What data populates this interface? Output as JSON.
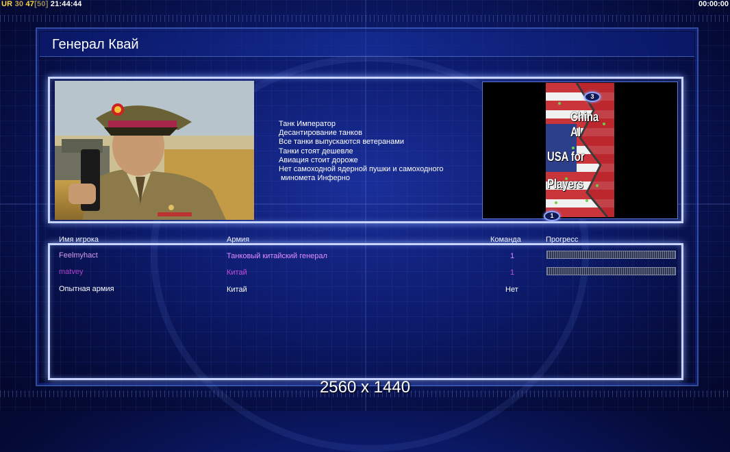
{
  "status": {
    "ur": "UR",
    "v1": "30",
    "v2": "47",
    "v3": "[50]",
    "clock": "21:44:44",
    "timer": "00:00:00"
  },
  "title": "Генерал Квай",
  "features": [
    "Танк Император",
    "Десантирование танков",
    "Все танки выпускаются ветеранами",
    "Танки стоят дешевле",
    "Авиация стоит дороже",
    "Нет самоходной ядерной пушки и самоходного",
    " минометa Инферно"
  ],
  "map": {
    "line1": "China AI",
    "line2": "USA for",
    "line3": "Players",
    "marker_top": "3",
    "marker_bottom": "1"
  },
  "table": {
    "headers": {
      "player": "Имя игрока",
      "army": "Армия",
      "team": "Команда",
      "progress": "Прогресс"
    },
    "rows": [
      {
        "player": "Feelmyhact",
        "army": "Танковый китайский генерал",
        "team": "1",
        "color": "#d79ce8",
        "armyColor": "#e28cff",
        "progress": true
      },
      {
        "player": "matvey",
        "army": "Китай",
        "team": "1",
        "color": "#b040c8",
        "armyColor": "#c64cde",
        "progress": true
      },
      {
        "player": "Опытная армия",
        "army": "Китай",
        "team": "Нет",
        "color": "#ffffff",
        "armyColor": "#ffffff",
        "progress": false
      }
    ]
  },
  "watermark": "2560 x 1440",
  "colors": {
    "accent": "#c8d4ff",
    "background": "#0c1a6a",
    "status_yellow": "#ffe23a"
  }
}
